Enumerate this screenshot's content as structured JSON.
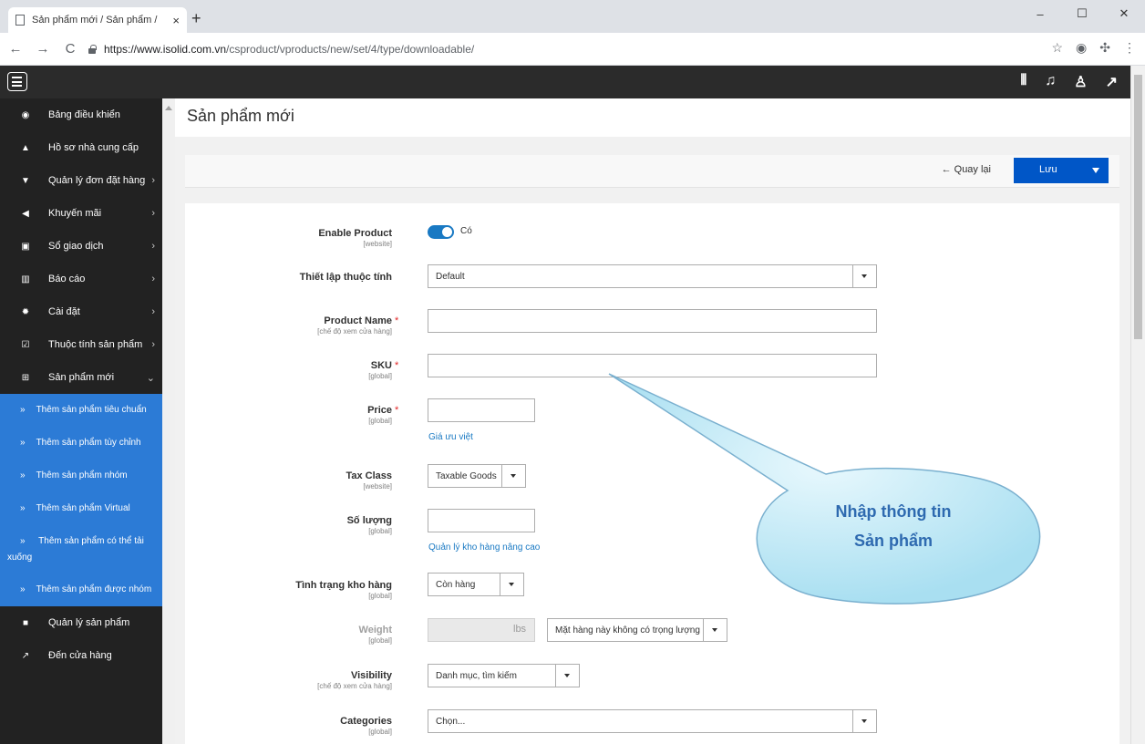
{
  "browser": {
    "tab_title": "Sản phẩm mới / Sản phẩm /",
    "tab_close": "×",
    "new_tab": "+",
    "win_min": "–",
    "win_max": "☐",
    "win_close": "✕",
    "url_host": "https://www.isolid.com.vn",
    "url_path": "/csproduct/vproducts/new/set/4/type/downloadable/",
    "icons": [
      "star-icon",
      "profile-icon",
      "extension-icon",
      "menu-icon"
    ]
  },
  "header": {
    "icons": [
      "equalizer-icon",
      "notifications-icon",
      "user-icon",
      "external-link-icon"
    ]
  },
  "sidebar": {
    "items": [
      {
        "label": "Bảng điều khiển",
        "icon": "dashboard-icon",
        "glyph": "◉",
        "chevron": ""
      },
      {
        "label": "Hồ sơ nhà cung cấp",
        "icon": "user-icon",
        "glyph": "▲",
        "chevron": ""
      },
      {
        "label": "Quản lý đơn đặt hàng",
        "icon": "cart-icon",
        "glyph": "▼",
        "chevron": "›"
      },
      {
        "label": "Khuyến mãi",
        "icon": "megaphone-icon",
        "glyph": "◀",
        "chevron": "›"
      },
      {
        "label": "Sổ giao dịch",
        "icon": "money-icon",
        "glyph": "▣",
        "chevron": "›"
      },
      {
        "label": "Báo cáo",
        "icon": "bar-chart-icon",
        "glyph": "▥",
        "chevron": "›"
      },
      {
        "label": "Cài đặt",
        "icon": "gear-icon",
        "glyph": "✹",
        "chevron": "›"
      },
      {
        "label": "Thuộc tính sản phẩm",
        "icon": "checkbox-icon",
        "glyph": "☑",
        "chevron": "›"
      },
      {
        "label": "Sản phẩm mới",
        "icon": "plus-square-icon",
        "glyph": "⊞",
        "chevron": "⌄"
      }
    ],
    "subitems": [
      "Thêm sản phẩm tiêu chuẩn",
      "Thêm sản phẩm tùy chỉnh",
      "Thêm sản phẩm nhóm",
      "Thêm sản phẩm Virtual",
      "Thêm sản phẩm có thể tải xuống",
      "Thêm sản phẩm được nhóm"
    ],
    "bottom_items": [
      {
        "label": "Quản lý sản phẩm",
        "icon": "folder-icon",
        "glyph": "■"
      },
      {
        "label": "Đến cửa hàng",
        "icon": "external-link-icon",
        "glyph": "↗"
      }
    ]
  },
  "page": {
    "title": "Sản phẩm mới",
    "back_label": "← Quay lại",
    "save_label": "Lưu"
  },
  "form": {
    "enable_product": {
      "label": "Enable Product",
      "scope": "[website]",
      "state": "Có",
      "enabled": true
    },
    "attribute_set": {
      "label": "Thiết lập thuộc tính",
      "value": "Default"
    },
    "product_name": {
      "label": "Product Name",
      "scope": "[chế độ xem cửa hàng]",
      "value": "",
      "required": "*"
    },
    "sku": {
      "label": "SKU",
      "scope": "[global]",
      "value": "",
      "required": "*"
    },
    "price": {
      "label": "Price",
      "scope": "[global]",
      "value": "",
      "required": "*",
      "link": "Giá ưu việt"
    },
    "tax_class": {
      "label": "Tax Class",
      "scope": "[website]",
      "value": "Taxable Goods"
    },
    "quantity": {
      "label": "Số lượng",
      "scope": "[global]",
      "value": "",
      "link": "Quản lý kho hàng nâng cao"
    },
    "stock_status": {
      "label": "Tình trạng kho hàng",
      "scope": "[global]",
      "value": "Còn hàng"
    },
    "weight": {
      "label": "Weight",
      "scope": "[global]",
      "unit": "lbs",
      "option": "Mặt hàng này không có trọng lượng"
    },
    "visibility": {
      "label": "Visibility",
      "scope": "[chế độ xem cửa hàng]",
      "value": "Danh mục, tìm kiếm"
    },
    "categories": {
      "label": "Categories",
      "scope": "[global]",
      "placeholder": "Chọn..."
    }
  },
  "callout": {
    "line1": "Nhập thông tin",
    "line2": "Sản phẩm",
    "fill": "#c9ecf7",
    "stroke": "#7ab0cf",
    "text_color": "#2e6ab0"
  }
}
